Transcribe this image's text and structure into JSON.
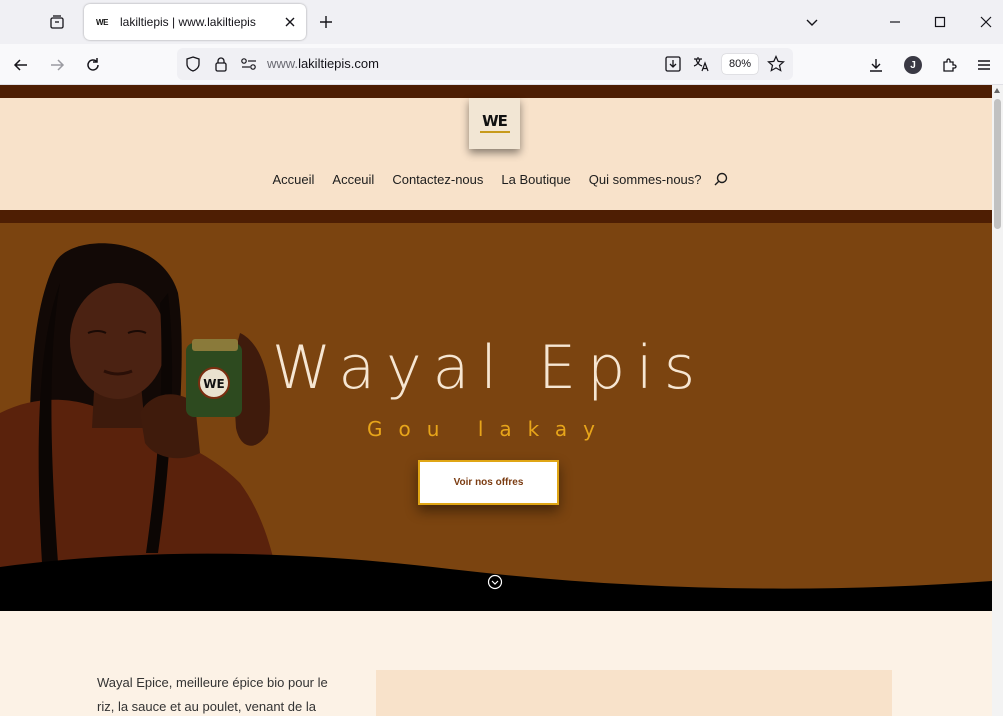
{
  "browser": {
    "tab_title": "lakiltiepis | www.lakiltiepis",
    "favicon_text": "WE",
    "url_prefix": "www.",
    "url_host": "lakiltiepis.com",
    "zoom": "80%",
    "profile_initial": "J",
    "icons": [
      "tab-list-icon",
      "close-icon",
      "plus-icon",
      "chevron-down-icon",
      "minimize-icon",
      "maximize-icon",
      "window-close-icon",
      "back-arrow-icon",
      "forward-arrow-icon",
      "reload-icon",
      "shield-icon",
      "lock-icon",
      "permissions-icon",
      "page-download-icon",
      "translate-icon",
      "star-icon",
      "downloads-icon",
      "extensions-icon",
      "hamburger-menu-icon"
    ]
  },
  "site": {
    "logo_text": "WE",
    "menu": [
      "Accueil",
      "Acceuil",
      "Contactez-nous",
      "La Boutique",
      "Qui sommes-nous?"
    ],
    "hero": {
      "title": "Wayal Epis",
      "subtitle": "Gou lakay",
      "cta": "Voir nos offres",
      "jar_label": "WE"
    },
    "intro_text": "Wayal Epice, meilleure épice bio pour le riz, la sauce et au poulet, venant de la",
    "colors": {
      "dark_band": "#4e1e03",
      "header_bg": "#f8e2ca",
      "hero_bg": "#7b4410",
      "accent_gold": "#e7a51a",
      "page_bg": "#fcf2e6"
    }
  }
}
